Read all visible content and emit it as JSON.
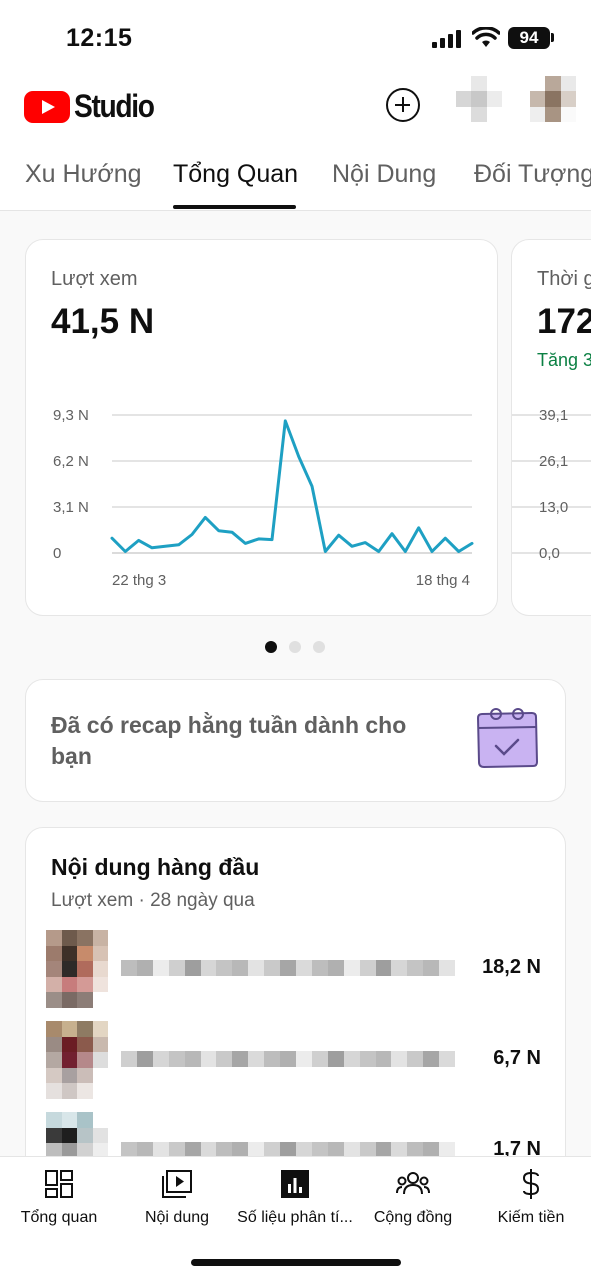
{
  "status_bar": {
    "time": "12:15",
    "battery": "94"
  },
  "header": {
    "logo_text": "Studio",
    "brand_color": "#ff0000"
  },
  "tabs": [
    {
      "label": "Xu Hướng",
      "active": false
    },
    {
      "label": "Tổng Quan",
      "active": true
    },
    {
      "label": "Nội Dung",
      "active": false
    },
    {
      "label": "Đối Tượng",
      "active": false
    }
  ],
  "metric_cards": [
    {
      "label": "Lượt xem",
      "value": "41,5 N",
      "y_ticks": [
        "9,3 N",
        "6,2 N",
        "3,1 N",
        "0"
      ],
      "x_ticks": [
        "22 thg 3",
        "18 thg 4"
      ]
    },
    {
      "label": "Thời g",
      "value": "172",
      "sub": "Tăng 3",
      "y_ticks": [
        "39,1",
        "26,1",
        "13,0",
        "0,0"
      ]
    }
  ],
  "chart_data": {
    "type": "line",
    "title": "Lượt xem",
    "x_start": "22 thg 3",
    "x_end": "18 thg 4",
    "ylim": [
      0,
      9300
    ],
    "y_ticks": [
      "0",
      "3,1 N",
      "6,2 N",
      "9,3 N"
    ],
    "line_color": "#1ea0c3",
    "series": [
      {
        "values": [
          1000,
          100,
          850,
          350,
          450,
          550,
          1250,
          2400,
          1500,
          1400,
          650,
          950,
          900,
          8900,
          6500,
          4500,
          100,
          1200,
          450,
          700,
          100,
          1300,
          100,
          1700,
          100,
          1000,
          100,
          650
        ]
      }
    ]
  },
  "carousel": {
    "page_count": 3,
    "active_index": 0
  },
  "recap": {
    "text": "Đã có recap hằng tuần dành cho bạn"
  },
  "top_content": {
    "title": "Nội dung hàng đầu",
    "subtitle": "Lượt xem · 28 ngày qua",
    "items": [
      {
        "value": "18,2 N"
      },
      {
        "value": "6,7 N"
      },
      {
        "value": "1,7 N"
      }
    ]
  },
  "bottom_nav": [
    {
      "label": "Tổng quan",
      "icon": "dashboard-icon"
    },
    {
      "label": "Nội dung",
      "icon": "content-icon"
    },
    {
      "label": "Số liệu phân tí...",
      "icon": "analytics-icon"
    },
    {
      "label": "Cộng đồng",
      "icon": "community-icon"
    },
    {
      "label": "Kiếm tiền",
      "icon": "dollar-icon"
    }
  ]
}
